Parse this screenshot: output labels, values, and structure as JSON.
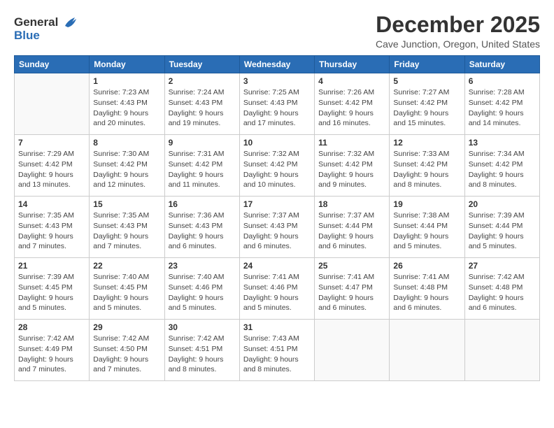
{
  "header": {
    "logo_line1": "General",
    "logo_line2": "Blue",
    "title": "December 2025",
    "subtitle": "Cave Junction, Oregon, United States"
  },
  "calendar": {
    "days_of_week": [
      "Sunday",
      "Monday",
      "Tuesday",
      "Wednesday",
      "Thursday",
      "Friday",
      "Saturday"
    ],
    "weeks": [
      [
        {
          "day": "",
          "info": ""
        },
        {
          "day": "1",
          "info": "Sunrise: 7:23 AM\nSunset: 4:43 PM\nDaylight: 9 hours\nand 20 minutes."
        },
        {
          "day": "2",
          "info": "Sunrise: 7:24 AM\nSunset: 4:43 PM\nDaylight: 9 hours\nand 19 minutes."
        },
        {
          "day": "3",
          "info": "Sunrise: 7:25 AM\nSunset: 4:43 PM\nDaylight: 9 hours\nand 17 minutes."
        },
        {
          "day": "4",
          "info": "Sunrise: 7:26 AM\nSunset: 4:42 PM\nDaylight: 9 hours\nand 16 minutes."
        },
        {
          "day": "5",
          "info": "Sunrise: 7:27 AM\nSunset: 4:42 PM\nDaylight: 9 hours\nand 15 minutes."
        },
        {
          "day": "6",
          "info": "Sunrise: 7:28 AM\nSunset: 4:42 PM\nDaylight: 9 hours\nand 14 minutes."
        }
      ],
      [
        {
          "day": "7",
          "info": "Sunrise: 7:29 AM\nSunset: 4:42 PM\nDaylight: 9 hours\nand 13 minutes."
        },
        {
          "day": "8",
          "info": "Sunrise: 7:30 AM\nSunset: 4:42 PM\nDaylight: 9 hours\nand 12 minutes."
        },
        {
          "day": "9",
          "info": "Sunrise: 7:31 AM\nSunset: 4:42 PM\nDaylight: 9 hours\nand 11 minutes."
        },
        {
          "day": "10",
          "info": "Sunrise: 7:32 AM\nSunset: 4:42 PM\nDaylight: 9 hours\nand 10 minutes."
        },
        {
          "day": "11",
          "info": "Sunrise: 7:32 AM\nSunset: 4:42 PM\nDaylight: 9 hours\nand 9 minutes."
        },
        {
          "day": "12",
          "info": "Sunrise: 7:33 AM\nSunset: 4:42 PM\nDaylight: 9 hours\nand 8 minutes."
        },
        {
          "day": "13",
          "info": "Sunrise: 7:34 AM\nSunset: 4:42 PM\nDaylight: 9 hours\nand 8 minutes."
        }
      ],
      [
        {
          "day": "14",
          "info": "Sunrise: 7:35 AM\nSunset: 4:43 PM\nDaylight: 9 hours\nand 7 minutes."
        },
        {
          "day": "15",
          "info": "Sunrise: 7:35 AM\nSunset: 4:43 PM\nDaylight: 9 hours\nand 7 minutes."
        },
        {
          "day": "16",
          "info": "Sunrise: 7:36 AM\nSunset: 4:43 PM\nDaylight: 9 hours\nand 6 minutes."
        },
        {
          "day": "17",
          "info": "Sunrise: 7:37 AM\nSunset: 4:43 PM\nDaylight: 9 hours\nand 6 minutes."
        },
        {
          "day": "18",
          "info": "Sunrise: 7:37 AM\nSunset: 4:44 PM\nDaylight: 9 hours\nand 6 minutes."
        },
        {
          "day": "19",
          "info": "Sunrise: 7:38 AM\nSunset: 4:44 PM\nDaylight: 9 hours\nand 5 minutes."
        },
        {
          "day": "20",
          "info": "Sunrise: 7:39 AM\nSunset: 4:44 PM\nDaylight: 9 hours\nand 5 minutes."
        }
      ],
      [
        {
          "day": "21",
          "info": "Sunrise: 7:39 AM\nSunset: 4:45 PM\nDaylight: 9 hours\nand 5 minutes."
        },
        {
          "day": "22",
          "info": "Sunrise: 7:40 AM\nSunset: 4:45 PM\nDaylight: 9 hours\nand 5 minutes."
        },
        {
          "day": "23",
          "info": "Sunrise: 7:40 AM\nSunset: 4:46 PM\nDaylight: 9 hours\nand 5 minutes."
        },
        {
          "day": "24",
          "info": "Sunrise: 7:41 AM\nSunset: 4:46 PM\nDaylight: 9 hours\nand 5 minutes."
        },
        {
          "day": "25",
          "info": "Sunrise: 7:41 AM\nSunset: 4:47 PM\nDaylight: 9 hours\nand 6 minutes."
        },
        {
          "day": "26",
          "info": "Sunrise: 7:41 AM\nSunset: 4:48 PM\nDaylight: 9 hours\nand 6 minutes."
        },
        {
          "day": "27",
          "info": "Sunrise: 7:42 AM\nSunset: 4:48 PM\nDaylight: 9 hours\nand 6 minutes."
        }
      ],
      [
        {
          "day": "28",
          "info": "Sunrise: 7:42 AM\nSunset: 4:49 PM\nDaylight: 9 hours\nand 7 minutes."
        },
        {
          "day": "29",
          "info": "Sunrise: 7:42 AM\nSunset: 4:50 PM\nDaylight: 9 hours\nand 7 minutes."
        },
        {
          "day": "30",
          "info": "Sunrise: 7:42 AM\nSunset: 4:51 PM\nDaylight: 9 hours\nand 8 minutes."
        },
        {
          "day": "31",
          "info": "Sunrise: 7:43 AM\nSunset: 4:51 PM\nDaylight: 9 hours\nand 8 minutes."
        },
        {
          "day": "",
          "info": ""
        },
        {
          "day": "",
          "info": ""
        },
        {
          "day": "",
          "info": ""
        }
      ]
    ]
  }
}
